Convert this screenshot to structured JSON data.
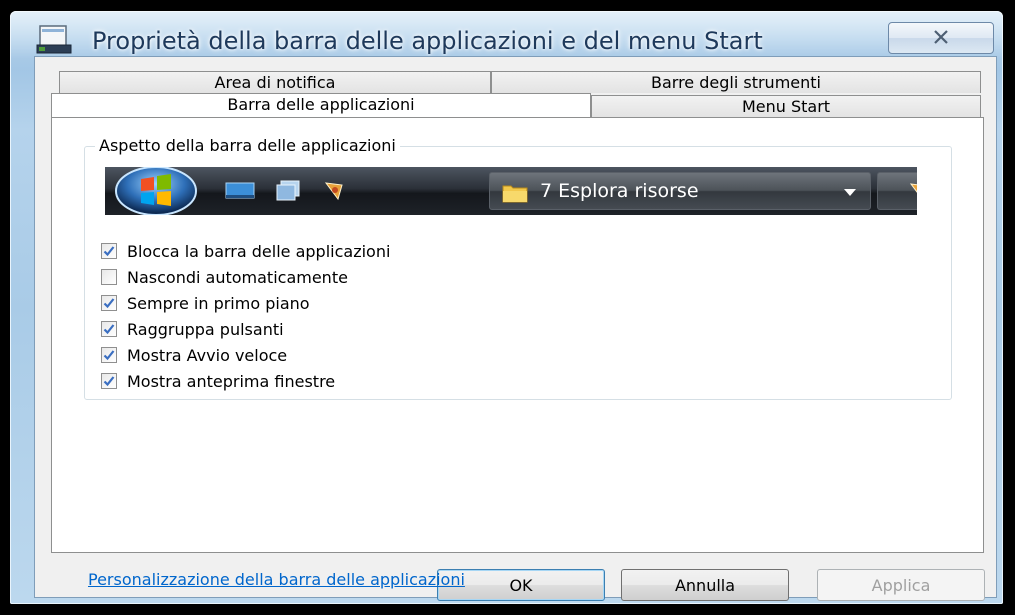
{
  "window": {
    "title": "Proprietà della barra delle applicazioni e del menu Start",
    "icon": "taskbar-properties-icon"
  },
  "tabs": {
    "row1": [
      "Area di notifica",
      "Barre degli strumenti"
    ],
    "row2": [
      "Barra delle applicazioni",
      "Menu Start"
    ],
    "active": "Barra delle applicazioni"
  },
  "group": {
    "label": "Aspetto della barra delle applicazioni",
    "preview_task_label": "7 Esplora risorse"
  },
  "options": [
    {
      "label": "Blocca la barra delle applicazioni",
      "checked": true
    },
    {
      "label": "Nascondi automaticamente",
      "checked": false
    },
    {
      "label": "Sempre in primo piano",
      "checked": true
    },
    {
      "label": "Raggruppa pulsanti",
      "checked": true
    },
    {
      "label": "Mostra Avvio veloce",
      "checked": true
    },
    {
      "label": "Mostra anteprima finestre",
      "checked": true
    }
  ],
  "link": "Personalizzazione della barra delle applicazioni",
  "buttons": {
    "ok": "OK",
    "cancel": "Annulla",
    "apply": "Applica"
  },
  "colors": {
    "link": "#0066cc",
    "check": "#3a6ec1",
    "title_text": "#1e395b"
  }
}
